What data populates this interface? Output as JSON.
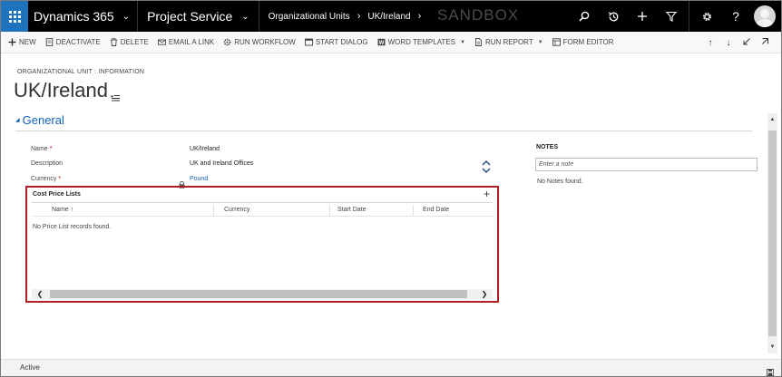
{
  "topnav": {
    "app_name": "Dynamics 365",
    "area_name": "Project Service",
    "breadcrumb": [
      "Organizational Units",
      "UK/Ireland"
    ],
    "environment_label": "SANDBOX"
  },
  "commands": [
    {
      "label": "NEW",
      "icon": "plus-icon"
    },
    {
      "label": "DEACTIVATE",
      "icon": "deactivate-icon"
    },
    {
      "label": "DELETE",
      "icon": "trash-icon"
    },
    {
      "label": "EMAIL A LINK",
      "icon": "email-icon"
    },
    {
      "label": "RUN WORKFLOW",
      "icon": "workflow-icon"
    },
    {
      "label": "START DIALOG",
      "icon": "dialog-icon"
    },
    {
      "label": "WORD TEMPLATES",
      "icon": "word-icon",
      "dropdown": true
    },
    {
      "label": "RUN REPORT",
      "icon": "report-icon",
      "dropdown": true
    },
    {
      "label": "FORM EDITOR",
      "icon": "form-editor-icon"
    }
  ],
  "header": {
    "entity_type": "ORGANIZATIONAL UNIT : INFORMATION",
    "title": "UK/Ireland"
  },
  "section": {
    "title": "General"
  },
  "fields": {
    "name": {
      "label": "Name",
      "value": "UK/Ireland",
      "required": true
    },
    "description": {
      "label": "Description",
      "value": "UK and Ireland Offices"
    },
    "currency": {
      "label": "Currency",
      "value": "Pound",
      "required": true
    }
  },
  "subgrid": {
    "title": "Cost Price Lists",
    "columns": [
      "Name ↑",
      "Currency",
      "Start Date",
      "End Date"
    ],
    "empty_message": "No Price List records found."
  },
  "notes": {
    "title": "NOTES",
    "placeholder": "Enter a note",
    "empty_message": "No Notes found."
  },
  "footer": {
    "status": "Active"
  },
  "colors": {
    "nav_bg": "#000000",
    "waffle_bg": "#1e73be",
    "link": "#1160b7",
    "highlight_border": "#b01e24",
    "required": "#cc0000"
  }
}
